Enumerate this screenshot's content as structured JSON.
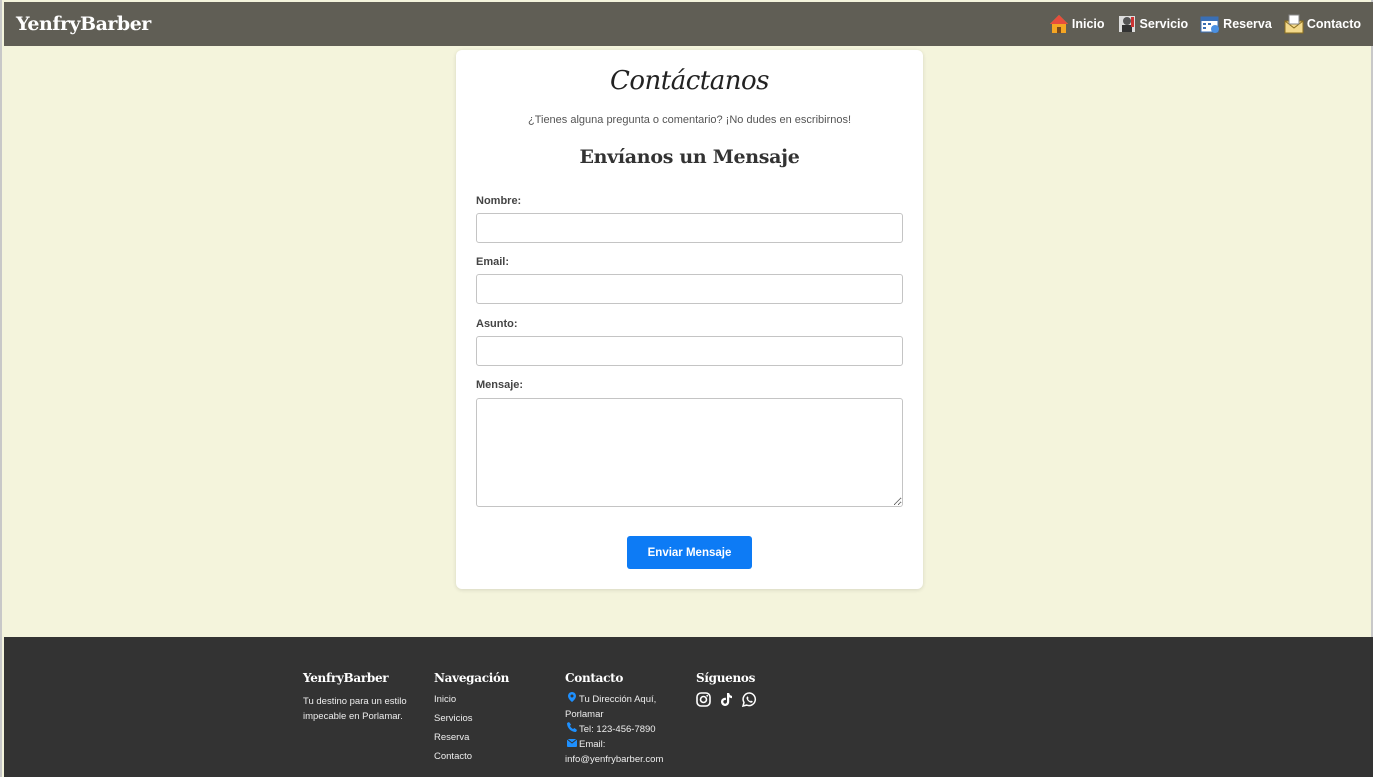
{
  "navbar": {
    "brand": "YenfryBarber",
    "links": [
      {
        "label": "Inicio",
        "icon": "house-icon"
      },
      {
        "label": "Servicio",
        "icon": "barber-icon"
      },
      {
        "label": "Reserva",
        "icon": "calendar-icon"
      },
      {
        "label": "Contacto",
        "icon": "envelope-icon"
      }
    ]
  },
  "contact": {
    "title": "Contáctanos",
    "subtitle": "¿Tienes alguna pregunta o comentario? ¡No dudes en escribirnos!",
    "form_title": "Envíanos un Mensaje",
    "fields": {
      "name_label": "Nombre:",
      "email_label": "Email:",
      "subject_label": "Asunto:",
      "message_label": "Mensaje:"
    },
    "submit_label": "Enviar Mensaje",
    "colors": {
      "button": "#0d7bf5"
    }
  },
  "footer": {
    "brand": {
      "title": "YenfryBarber",
      "text": "Tu destino para un estilo impecable en Porlamar."
    },
    "nav": {
      "title": "Navegación",
      "links": [
        "Inicio",
        "Servicios",
        "Reserva",
        "Contacto"
      ]
    },
    "contact": {
      "title": "Contacto",
      "address": "Tu Dirección Aquí, Porlamar",
      "phone": "Tel: 123-456-7890",
      "email_label": "Email:",
      "email": "info@yenfrybarber.com"
    },
    "social": {
      "title": "Síguenos",
      "icons": [
        "instagram-icon",
        "tiktok-icon",
        "whatsapp-icon"
      ]
    }
  }
}
